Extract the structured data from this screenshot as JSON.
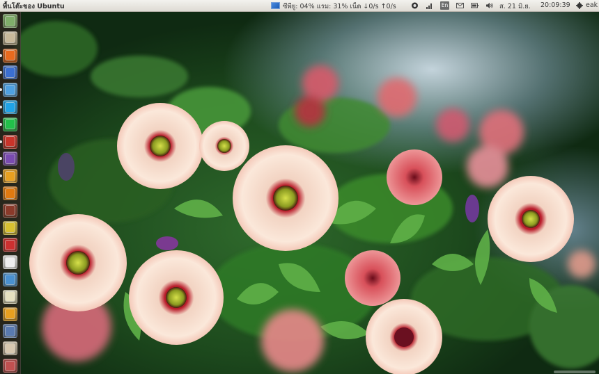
{
  "panel": {
    "window_title": "พื้นโต๊ะของ Ubuntu",
    "sysmon": {
      "label": "ซีพียู: 04% แรม: 31% เน็ต ↓0/s ↑0/s",
      "cpu_percent": 4,
      "ram_percent": 31
    },
    "keyboard_layout": "En",
    "date": "ส. 21 มิ.ย.",
    "time": "20:09:39",
    "user": "eak",
    "indicator_icons": [
      "ubuntu-one-icon",
      "network-signal-icon",
      "mail-icon",
      "battery-icon",
      "volume-icon",
      "gear-icon"
    ]
  },
  "launcher": {
    "items": [
      {
        "name": "dash-home",
        "color": "#7fae6a"
      },
      {
        "name": "files",
        "color": "#c9b99a"
      },
      {
        "name": "firefox",
        "color": "#e86a1e"
      },
      {
        "name": "chromium",
        "color": "#3b6fd1"
      },
      {
        "name": "pidgin",
        "color": "#4fa0e0"
      },
      {
        "name": "skype",
        "color": "#20a3e6"
      },
      {
        "name": "line",
        "color": "#22c04a"
      },
      {
        "name": "filezilla",
        "color": "#c8342a"
      },
      {
        "name": "emesene",
        "color": "#7a4bb0"
      },
      {
        "name": "vlc-orange",
        "color": "#e8a020"
      },
      {
        "name": "vlc",
        "color": "#e07a10"
      },
      {
        "name": "screenshot",
        "color": "#8a3a2a"
      },
      {
        "name": "rhythmbox",
        "color": "#d8c030"
      },
      {
        "name": "recorder",
        "color": "#cc3030"
      },
      {
        "name": "text-editor",
        "color": "#eeeeee"
      },
      {
        "name": "software-center",
        "color": "#4a90d0"
      },
      {
        "name": "notes",
        "color": "#e6e0c0"
      },
      {
        "name": "system-settings",
        "color": "#e8a020"
      },
      {
        "name": "workspace-switcher",
        "color": "#5a7ab0"
      },
      {
        "name": "calendar",
        "color": "#d8c8b0"
      },
      {
        "name": "trash",
        "color": "#c05050"
      }
    ]
  }
}
